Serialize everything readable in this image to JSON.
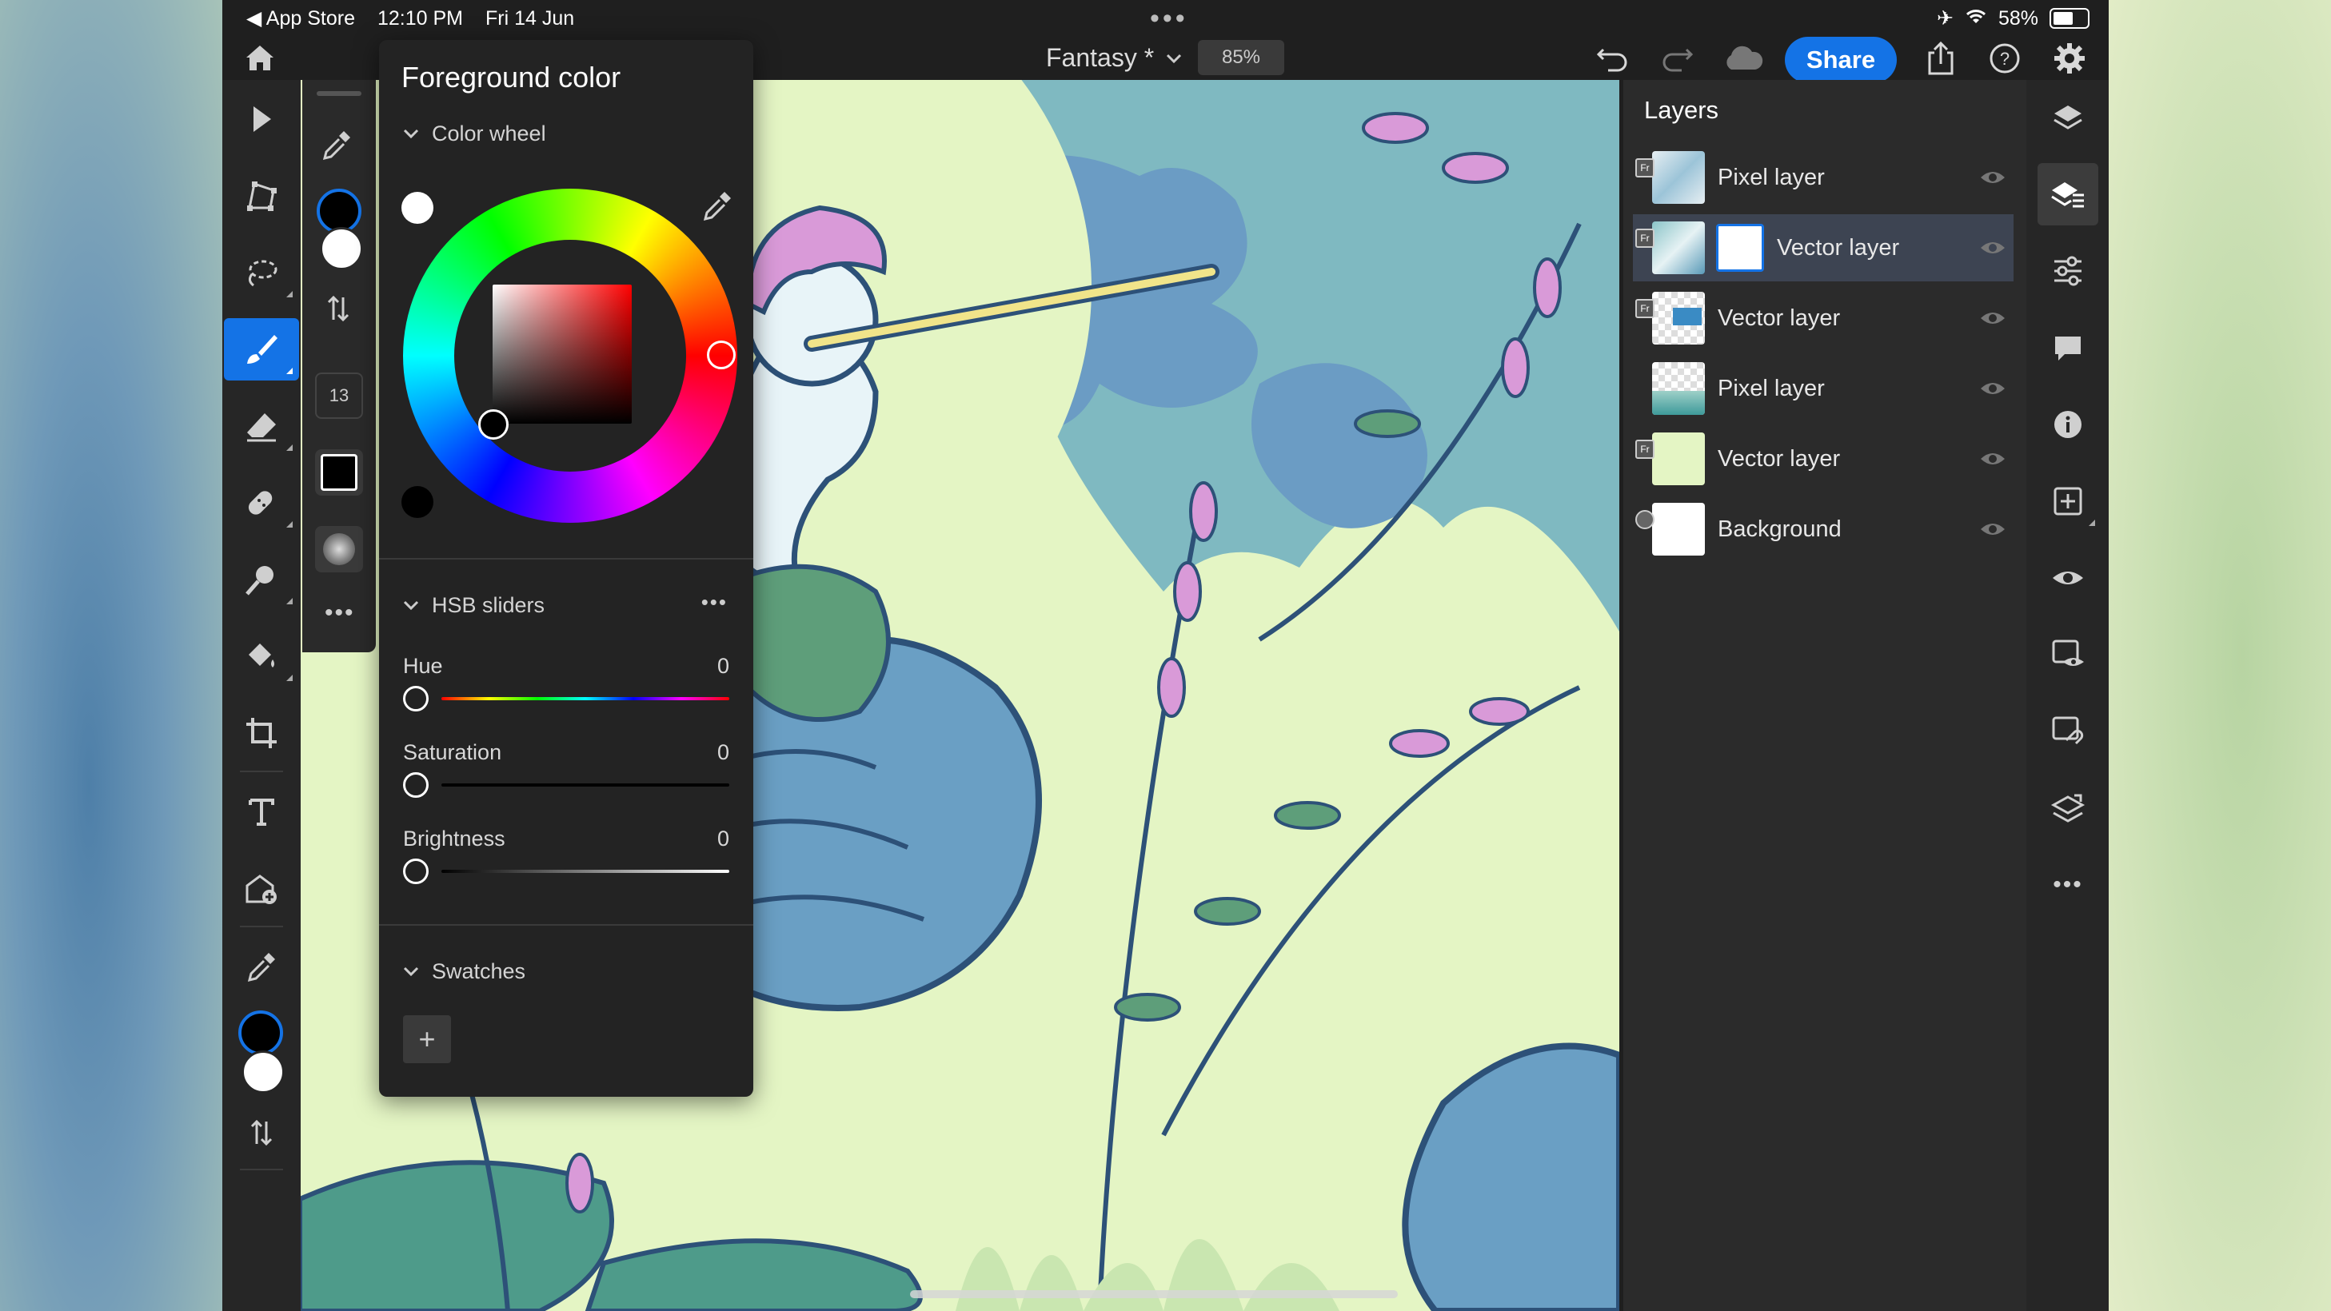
{
  "status_bar": {
    "back_app": "App Store",
    "time": "12:10 PM",
    "date": "Fri 14 Jun",
    "battery": "58%"
  },
  "top_bar": {
    "document_title": "Fantasy *",
    "zoom": "85%",
    "share_label": "Share"
  },
  "tool_options": {
    "brush_size": "13"
  },
  "color_panel": {
    "title": "Foreground color",
    "color_wheel_label": "Color wheel",
    "hsb_label": "HSB sliders",
    "hsb_more": "•••",
    "sliders": [
      {
        "label": "Hue",
        "value": "0"
      },
      {
        "label": "Saturation",
        "value": "0"
      },
      {
        "label": "Brightness",
        "value": "0"
      }
    ],
    "swatches_label": "Swatches",
    "add_swatch": "+",
    "hue_degrees": 0,
    "current_color": "#000000"
  },
  "layers_panel": {
    "title": "Layers",
    "layers": [
      {
        "name": "Pixel layer",
        "badge": "Fr",
        "selected": false
      },
      {
        "name": "Vector layer",
        "badge": "Fr",
        "selected": true
      },
      {
        "name": "Vector layer",
        "badge": "Fr",
        "selected": false
      },
      {
        "name": "Pixel layer",
        "badge": "",
        "selected": false
      },
      {
        "name": "Vector layer",
        "badge": "Fr",
        "selected": false
      },
      {
        "name": "Background",
        "badge": "",
        "selected": false
      }
    ]
  },
  "colors": {
    "accent": "#1473e6",
    "panel": "#232323",
    "toolbar": "#262626",
    "canvas_bg": "#e4f5c4"
  },
  "icons": {
    "left_toolbar": [
      "select-icon",
      "transform-icon",
      "lasso-icon",
      "brush-icon",
      "eraser-icon",
      "healing-icon",
      "clone-icon",
      "fill-icon",
      "crop-icon",
      "type-icon",
      "place-image-icon",
      "eyedropper-icon",
      "foreground-color-icon",
      "swap-icon"
    ],
    "right_toolbar": [
      "layers-icon",
      "layer-properties-icon",
      "adjustments-icon",
      "comments-icon",
      "info-icon",
      "add-layer-icon",
      "visibility-icon",
      "mask-icon",
      "link-icon",
      "merge-icon",
      "more-icon"
    ]
  }
}
